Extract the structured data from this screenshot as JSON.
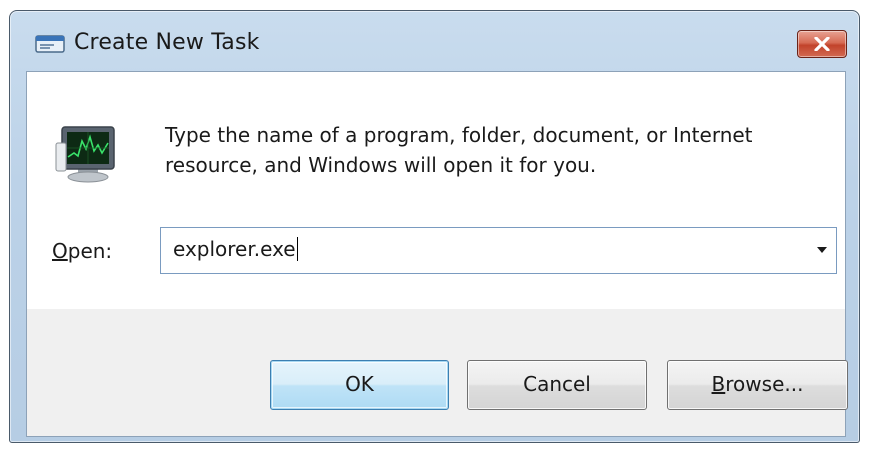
{
  "window": {
    "title": "Create New Task",
    "close_icon": "close-icon"
  },
  "dialog": {
    "description_line1": "Type the name of a program, folder, document, or Internet",
    "description_line2": "resource, and Windows will open it for you.",
    "open_label_accel": "O",
    "open_label_rest": "pen:",
    "open_value": "explorer.exe",
    "program_icon": "task-manager-icon"
  },
  "buttons": {
    "ok": "OK",
    "cancel": "Cancel",
    "browse_accel": "B",
    "browse_rest": "rowse..."
  },
  "colors": {
    "title_bar": "#bcd2e8",
    "close_button": "#c2432b",
    "default_button_border": "#3c7fb1"
  }
}
